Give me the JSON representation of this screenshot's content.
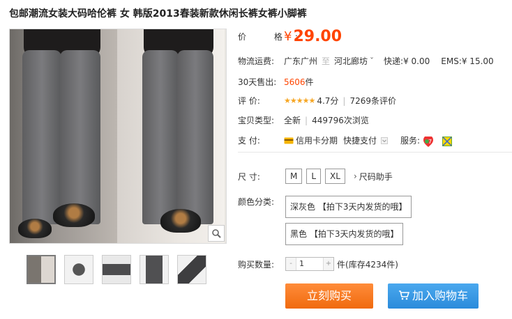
{
  "title": "包邮潮流女装大码哈伦裤 女 韩版2013春装新款休闲长裤女裤小脚裤",
  "price": {
    "label": "价 格:",
    "currency": "¥",
    "value": "29.00"
  },
  "shipping": {
    "label": "物流运费:",
    "from": "广东广州",
    "to_sep": "至",
    "to": "河北廊坊",
    "dropdown_glyph": "ˇ",
    "express": "快递:¥ 0.00",
    "ems": "EMS:¥ 15.00"
  },
  "sales": {
    "label": "30天售出:",
    "count": "5606",
    "unit": "件"
  },
  "rating": {
    "label": "评 价:",
    "stars": "★★★★★",
    "score": "4.7分",
    "reviews": "7269条评价"
  },
  "condition": {
    "label": "宝贝类型:",
    "type": "全新",
    "views": "449796次浏览"
  },
  "payment": {
    "label": "支 付:",
    "credit": "信用卡分期",
    "quick": "快捷支付",
    "service_label": "服务:"
  },
  "size": {
    "label": "尺 寸:",
    "options": [
      "M",
      "L",
      "XL"
    ],
    "helper": "尺码助手"
  },
  "color": {
    "label": "颜色分类:",
    "options": [
      "深灰色 【拍下3天内发货的哦】",
      "黑色 【拍下3天内发货的哦】"
    ]
  },
  "quantity": {
    "label": "购买数量:",
    "value": "1",
    "minus": "-",
    "plus": "+",
    "unit": "件",
    "stock": "(库存4234件)"
  },
  "actions": {
    "buy": "立刻购买",
    "cart": "加入购物车"
  },
  "colors": {
    "accent": "#ff4400",
    "buy_button": "#f06a0e",
    "cart_button": "#2b8bdb",
    "star": "#f6a623"
  },
  "icons": [
    "zoom-icon",
    "credit-card-icon",
    "service-seven-days-icon",
    "service-guarantee-icon",
    "cart-icon",
    "chevron-right-icon"
  ]
}
